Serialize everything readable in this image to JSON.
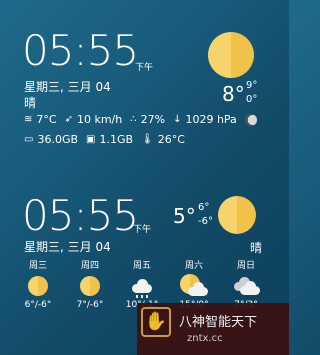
{
  "widget1": {
    "time": "05:55",
    "ampm": "下午",
    "date": "星期三, 三月 04",
    "condition": "晴",
    "temp": "8°",
    "high": "9°",
    "low": "0°",
    "details": {
      "temperature": "7°C",
      "wind": "10 km/h",
      "humidity": "27%",
      "pressure": "1029 hPa",
      "storage": "36.0GB",
      "memory": "1.1GB",
      "battery_temp": "26°C"
    }
  },
  "widget2": {
    "time": "05:55",
    "ampm": "下午",
    "date": "星期三, 三月 04",
    "condition": "晴",
    "temp": "5°",
    "high": "6°",
    "low": "-6°",
    "forecast": [
      {
        "day": "周三",
        "range": "6°/-6°",
        "icon": "sun-icon"
      },
      {
        "day": "周四",
        "range": "7°/-6°",
        "icon": "sun-icon"
      },
      {
        "day": "周五",
        "range": "10°/-1°",
        "icon": "rain-cloud-icon"
      },
      {
        "day": "周六",
        "range": "15°/0°",
        "icon": "partly-cloudy-icon"
      },
      {
        "day": "周日",
        "range": "7°/3°",
        "icon": "cloud-icon"
      }
    ]
  },
  "watermark": {
    "brand": "八神智能天下",
    "url": "zntx.cc"
  },
  "colors": {
    "sun_light": "#f6d36b",
    "sun_dark": "#f0c24a",
    "background": "#185a7a"
  }
}
